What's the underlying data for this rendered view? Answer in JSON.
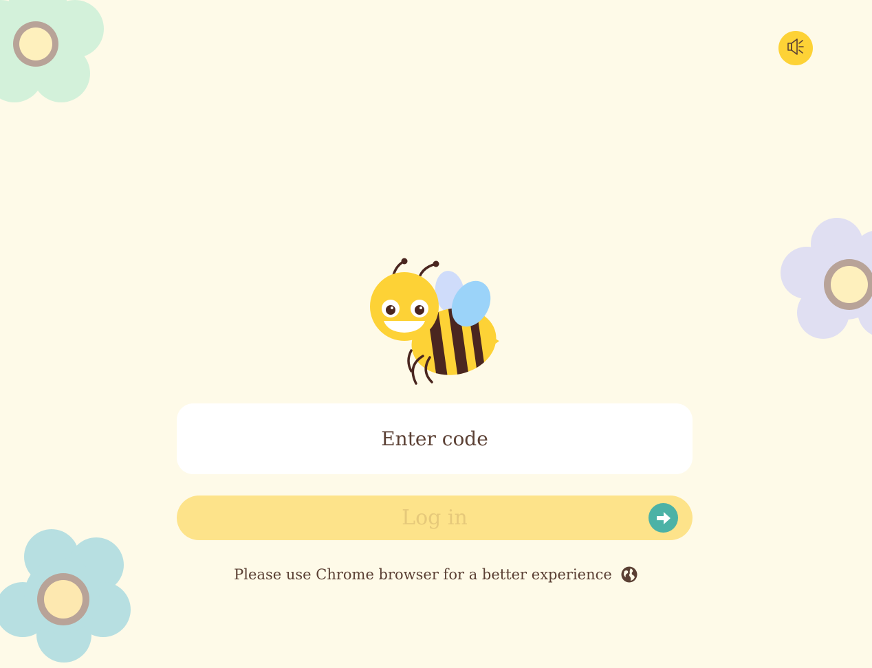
{
  "login": {
    "code_placeholder": "Enter code",
    "button_label": "Log in"
  },
  "footer": {
    "browser_notice": "Please use Chrome browser for a better experience"
  },
  "icons": {
    "sound": "speaker-icon",
    "submit": "arrow-right-icon",
    "language": "globe-icon",
    "mascot": "bee-mascot"
  },
  "colors": {
    "background": "#fefae8",
    "accent_yellow": "#fdd236",
    "button_fill": "#fde38a",
    "button_text": "#e6c97a",
    "arrow_teal": "#4cb2a6",
    "text_brown": "#5b4034",
    "flower_green": "#d3f1da",
    "flower_purple": "#e0dff2",
    "flower_blue": "#b7dfe1",
    "flower_ring": "#b8a398",
    "flower_center": "#feeab4"
  }
}
